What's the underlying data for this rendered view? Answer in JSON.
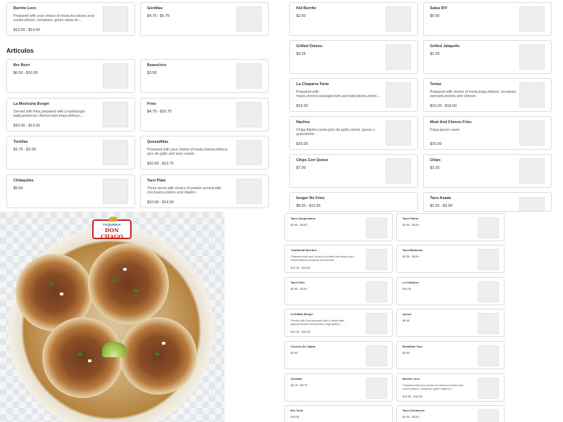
{
  "left_top": {
    "card1": {
      "name": "Burrito Loco",
      "desc": "Prepared with your choice of meat,rice,beans,sour cream,lettuce, tomatoes, green salsa on...",
      "price": "$12.50 - $14.50"
    },
    "card2": {
      "name": "Gorditas",
      "price": "$4.75 - $5.75"
    }
  },
  "section_articulos": "Articulos",
  "articulos": [
    {
      "name": "Bre Burri",
      "price": "$6.50 - $10.00"
    },
    {
      "name": "Beans/rice",
      "price": "$3.50"
    },
    {
      "name": "La Mexicana Burger",
      "desc": "Served with fries,prepared with a hamburger patty,american cheese,ham,mayo,lettuce,...",
      "price": "$10.00 - $13.00"
    },
    {
      "name": "Fries",
      "price": "$4.75 - $10.75"
    },
    {
      "name": "Tortillas",
      "price": "$1.75 - $2.00"
    },
    {
      "name": "Quesadillas",
      "desc": "Prepared with your choice of meat,cheese,lettuce, pico de gallo and sour cream.",
      "price": "$10.50 - $13.75"
    },
    {
      "name": "Chilaquiles",
      "price": "$9.50"
    },
    {
      "name": "Taco Plate",
      "desc": "Three tacos with choice of protein served with rice,beans,onions and cilantro.",
      "price": "$10.00 - $14.50"
    }
  ],
  "right_top": [
    {
      "name": "Kid Burrito",
      "price": "$2.50"
    },
    {
      "name": "Salsa R/V",
      "price": "$0.50"
    },
    {
      "name": "Grilled Onions",
      "price": "$3.25"
    },
    {
      "name": "Grilled Jalapeño",
      "price": "$1.00"
    },
    {
      "name": "La Chaparra Torta",
      "desc": "Prepared with mayo,chorizo,sausage,ham,avocado,beans,onion...",
      "price": "$15.00"
    },
    {
      "name": "Tortas",
      "desc": "Prepared with choice of meat,mayo,lettuce, tomatoes, avocado,onions and cheese.",
      "price": "$15.00 - $18.00"
    },
    {
      "name": "Nachos",
      "desc": "Chips,frijoles,carne,pico de gallo,crema ,queso y guacamole",
      "price": "$15.00"
    },
    {
      "name": "Meat And Cheese Fries",
      "desc": "Papa,queso carne",
      "price": "$15.50"
    },
    {
      "name": "Chips Con Queso",
      "price": "$7.00"
    },
    {
      "name": "Chips",
      "price": "$3.25"
    },
    {
      "name": "burger No Fries",
      "price": "$8.00 - $11.00"
    },
    {
      "name": "Taco Asada",
      "price": "$2.50 - $3.00"
    }
  ],
  "small_cards": [
    {
      "name": "Taco Campechano",
      "price": "$2.50 - $3.00"
    },
    {
      "name": "Taco Pastor",
      "price": "$2.50 - $3.00"
    },
    {
      "name": "Traditional Burritos",
      "desc": "Prepared with your choice of protein,rice,beans,sour cream,lettuce,tomatoes and cheese.",
      "price": "$11.00 - $13.50"
    },
    {
      "name": "Taco Barbacoa",
      "price": "$2.50 - $3.00"
    },
    {
      "name": "Taco Pollo",
      "price": "$2.50 - $3.00"
    },
    {
      "name": "La Callejera",
      "price": "$15.00"
    },
    {
      "name": "La Diabla Burger",
      "desc": "Served with fries,prepared with a hamburger patty,american cheese,ham,mayo,grilled...",
      "price": "$10.00 - $13.00"
    },
    {
      "name": "Queso",
      "price": "$4.50"
    },
    {
      "name": "Churros De Cajeta",
      "price": "$1.50"
    },
    {
      "name": "Breakfast Taco",
      "price": "$3.50"
    },
    {
      "name": "Gorditas",
      "price": "$4.75 - $5.75"
    },
    {
      "name": "Burrito Loco",
      "desc": "Prepared with your choice of meat,rice,beans,sour cream,lettuce, tomatoes, green salsa on...",
      "price": "$12.50 - $14.50"
    },
    {
      "name": "Bre Torta",
      "price": "$15.00"
    },
    {
      "name": "Taco Chicharron",
      "price": "$2.50 - $3.00"
    }
  ],
  "photo": {
    "logo_line1": "TAQUERIA",
    "logo_line2": "DON CHAGO"
  },
  "colors": {
    "card_border": "#dcdcdc",
    "thumb": "#eeeeee",
    "logo_red": "#c6231f",
    "logo_blue": "#1b5fa6"
  }
}
